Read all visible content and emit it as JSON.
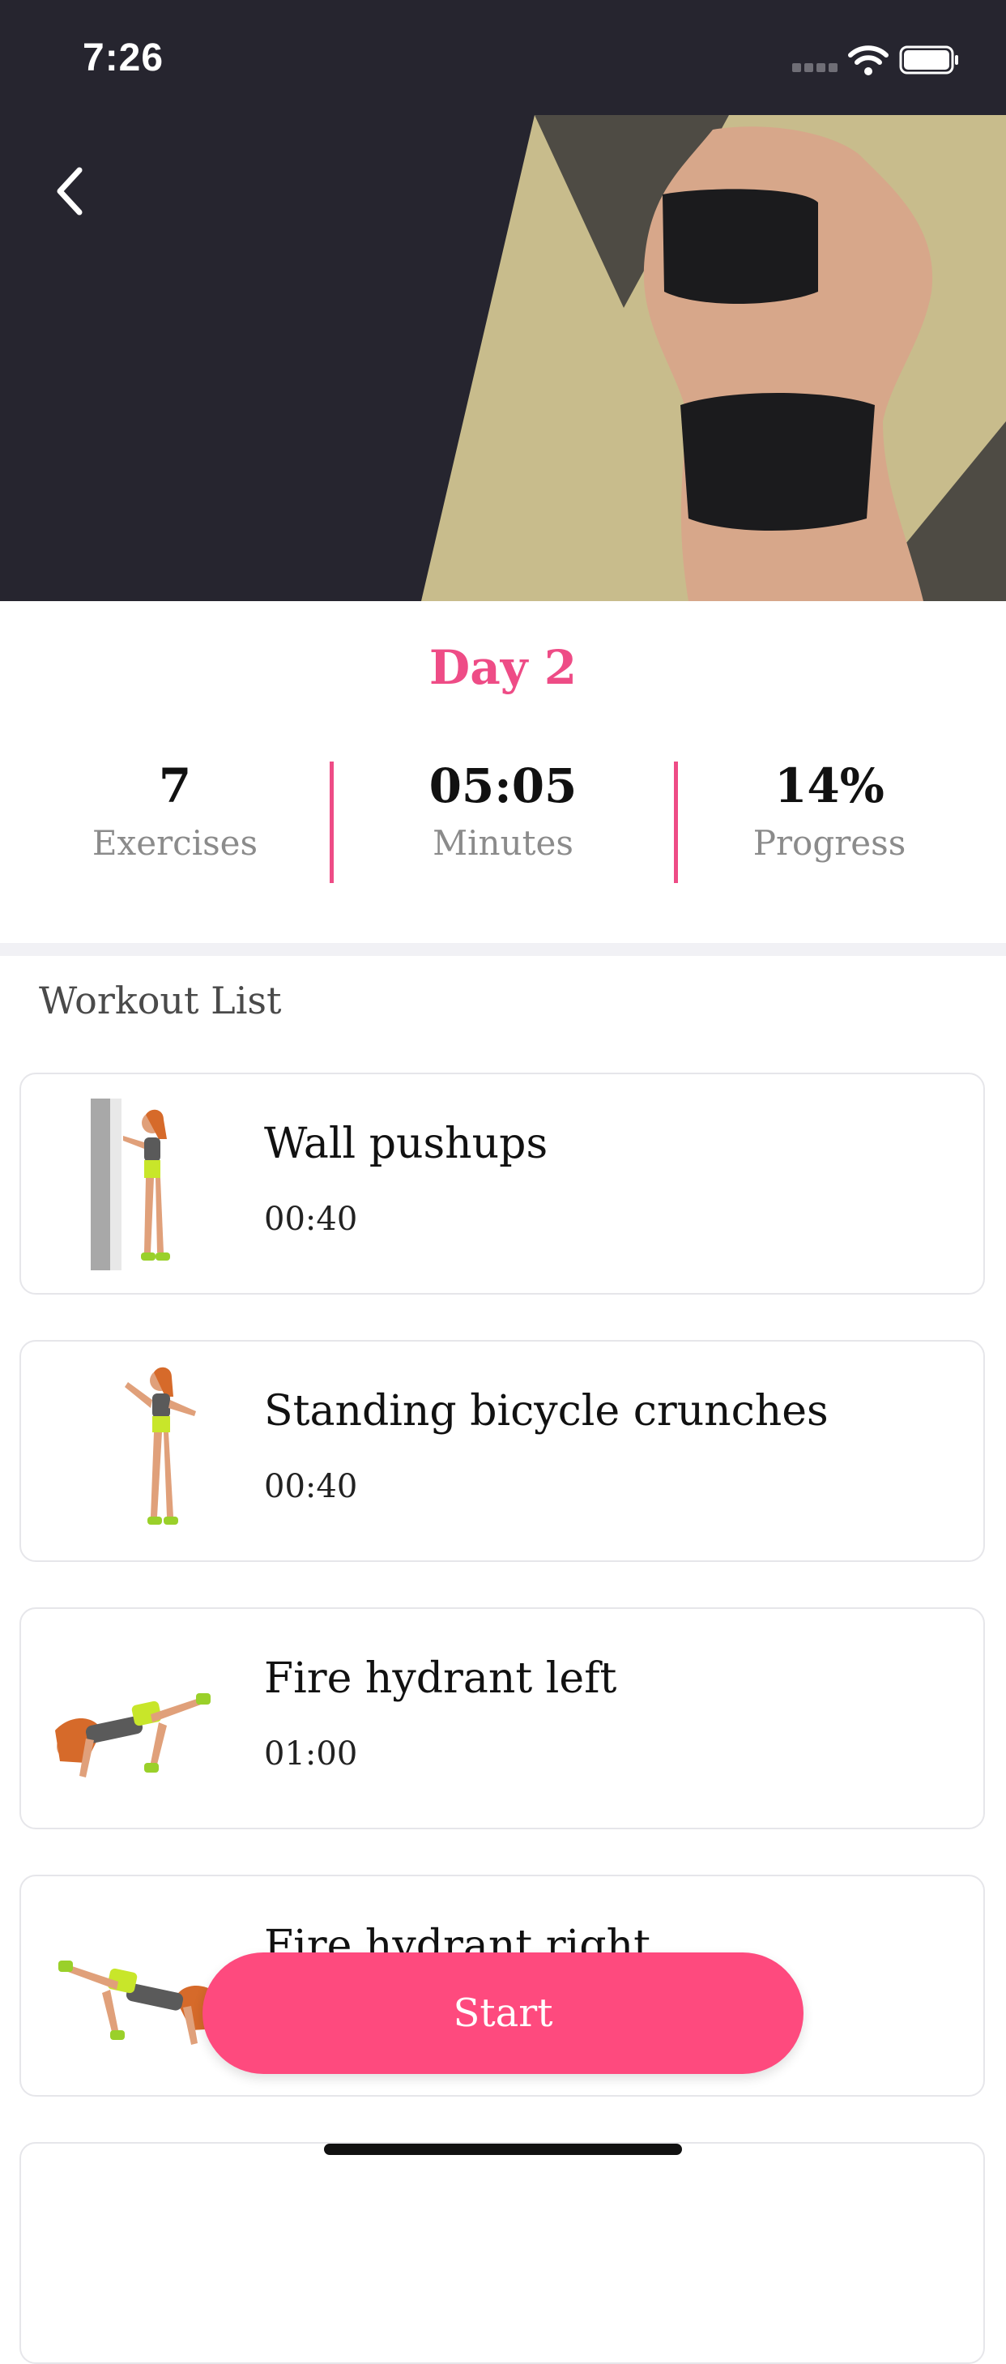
{
  "status_bar": {
    "time": "7:26"
  },
  "header": {
    "back_icon": "chevron-left-icon"
  },
  "day": {
    "title": "Day 2"
  },
  "stats": [
    {
      "value": "7",
      "label": "Exercises"
    },
    {
      "value": "05:05",
      "label": "Minutes"
    },
    {
      "value": "14%",
      "label": "Progress"
    }
  ],
  "workout_list": {
    "heading": "Workout List",
    "items": [
      {
        "name": "Wall pushups",
        "duration": "00:40"
      },
      {
        "name": "Standing bicycle crunches",
        "duration": "00:40"
      },
      {
        "name": "Fire hydrant left",
        "duration": "01:00"
      },
      {
        "name": "Fire hydrant right",
        "duration": ""
      }
    ]
  },
  "actions": {
    "start_label": "Start"
  },
  "colors": {
    "accent": "#ee4c86",
    "button": "#fe4a7e",
    "hero_dark": "#26252f",
    "hero_gold": "#c8bc8c"
  }
}
